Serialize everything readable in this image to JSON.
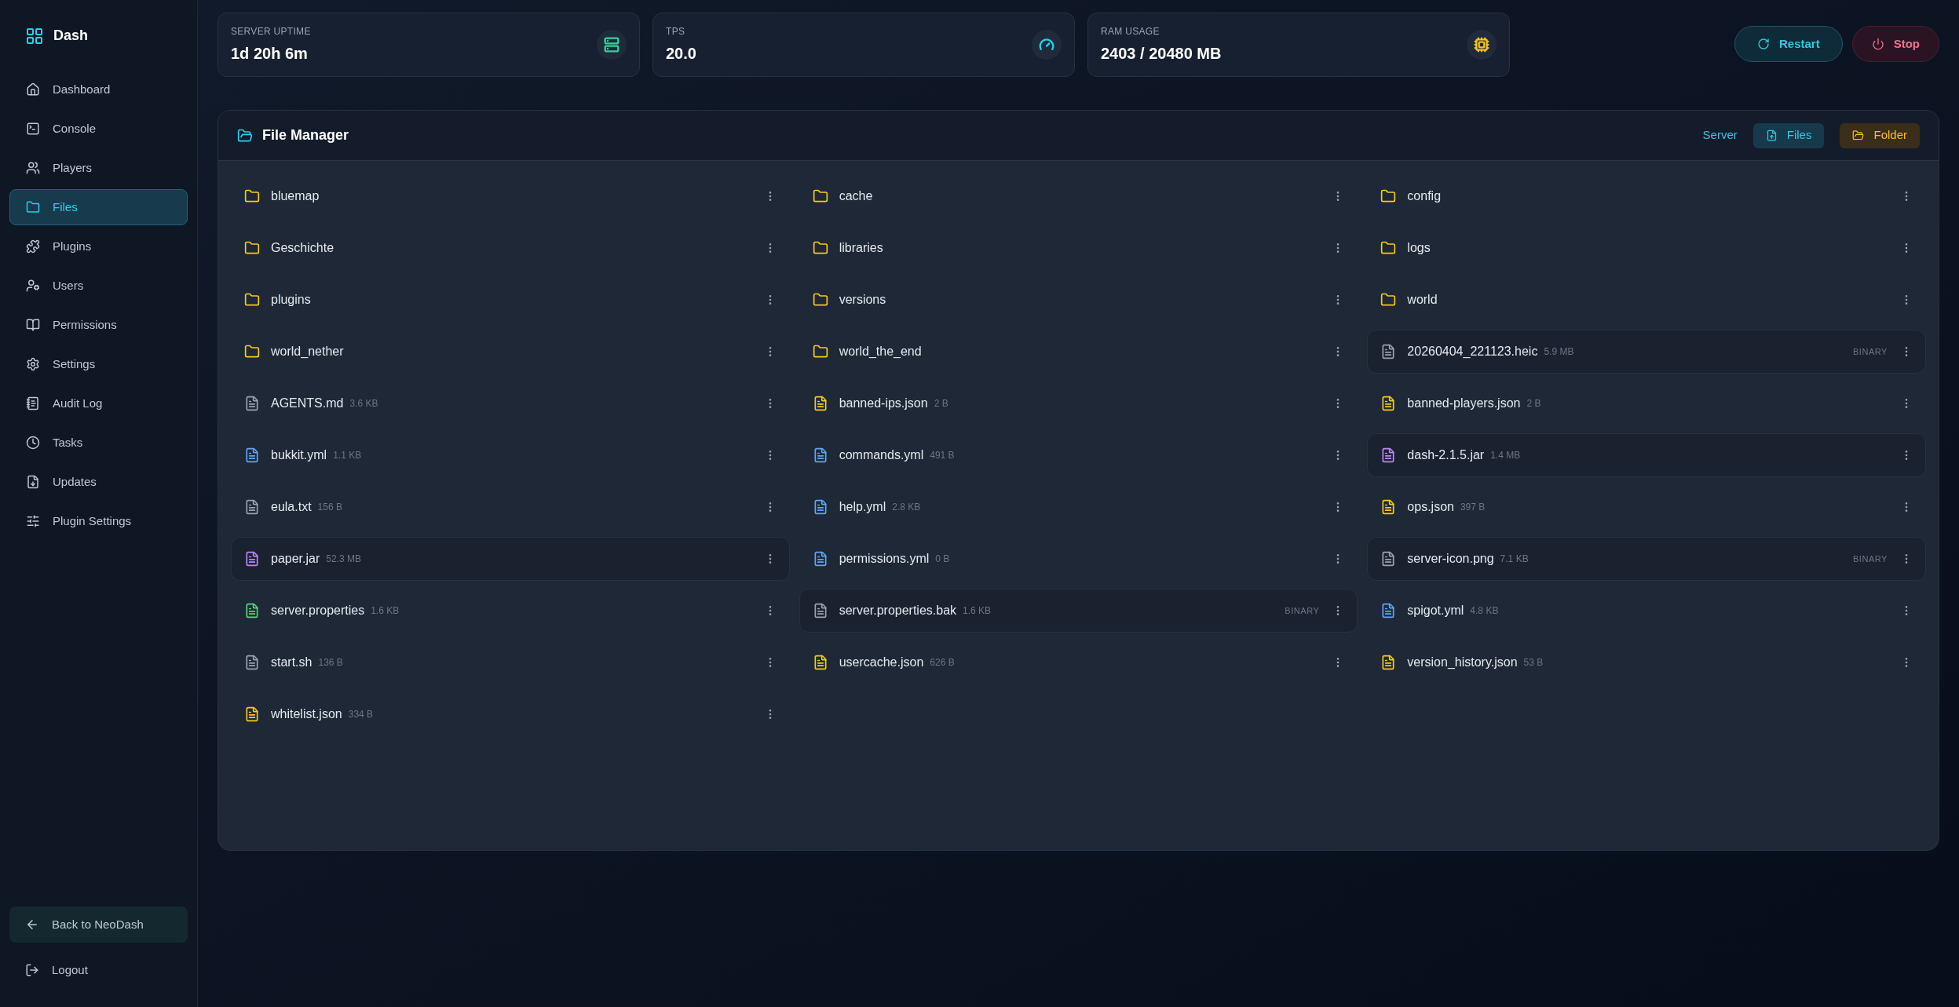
{
  "sidebar": {
    "brand": "Dash",
    "items": [
      {
        "label": "Dashboard",
        "selected": false
      },
      {
        "label": "Console",
        "selected": false
      },
      {
        "label": "Players",
        "selected": false
      },
      {
        "label": "Files",
        "selected": true
      },
      {
        "label": "Plugins",
        "selected": false
      },
      {
        "label": "Users",
        "selected": false
      },
      {
        "label": "Permissions",
        "selected": false
      },
      {
        "label": "Settings",
        "selected": false
      },
      {
        "label": "Audit Log",
        "selected": false
      },
      {
        "label": "Tasks",
        "selected": false
      },
      {
        "label": "Updates",
        "selected": false
      },
      {
        "label": "Plugin Settings",
        "selected": false
      }
    ],
    "footer": [
      {
        "label": "Back to NeoDash",
        "kind": "back"
      },
      {
        "label": "Logout",
        "kind": "logout"
      }
    ]
  },
  "stats": [
    {
      "label": "SERVER UPTIME",
      "value": "1d 20h 6m",
      "color": "#34d399"
    },
    {
      "label": "TPS",
      "value": "20.0",
      "color": "#22d3ee"
    },
    {
      "label": "RAM USAGE",
      "value": "2403 / 20480 MB",
      "color": "#fbbf24"
    }
  ],
  "actions": [
    {
      "label": "Restart",
      "kind": "restart"
    },
    {
      "label": "Stop",
      "kind": "stop"
    }
  ],
  "file_manager": {
    "title": "File Manager",
    "breadcrumb": "Server",
    "buttons": [
      {
        "label": "Files",
        "kind": "upload"
      },
      {
        "label": "Folder",
        "kind": "folder"
      }
    ],
    "items": [
      {
        "name": "bluemap",
        "kind": "folder",
        "color": "#facc15",
        "selected": false
      },
      {
        "name": "cache",
        "kind": "folder",
        "color": "#facc15",
        "selected": false
      },
      {
        "name": "config",
        "kind": "folder",
        "color": "#facc15",
        "selected": false
      },
      {
        "name": "Geschichte",
        "kind": "folder",
        "color": "#facc15",
        "selected": false
      },
      {
        "name": "libraries",
        "kind": "folder",
        "color": "#facc15",
        "selected": false
      },
      {
        "name": "logs",
        "kind": "folder",
        "color": "#facc15",
        "selected": false
      },
      {
        "name": "plugins",
        "kind": "folder",
        "color": "#facc15",
        "selected": false
      },
      {
        "name": "versions",
        "kind": "folder",
        "color": "#facc15",
        "selected": false
      },
      {
        "name": "world",
        "kind": "folder",
        "color": "#facc15",
        "selected": false
      },
      {
        "name": "world_nether",
        "kind": "folder",
        "color": "#facc15",
        "selected": false
      },
      {
        "name": "world_the_end",
        "kind": "folder",
        "color": "#facc15",
        "selected": false
      },
      {
        "name": "20260404_221123.heic",
        "kind": "file",
        "size": "5.9 MB",
        "badge": "BINARY",
        "color": "#9ca3af",
        "selected": true
      },
      {
        "name": "AGENTS.md",
        "kind": "file",
        "size": "3.6 KB",
        "color": "#9ca3af",
        "selected": false
      },
      {
        "name": "banned-ips.json",
        "kind": "file",
        "size": "2 B",
        "color": "#facc15",
        "selected": false
      },
      {
        "name": "banned-players.json",
        "kind": "file",
        "size": "2 B",
        "color": "#facc15",
        "selected": false
      },
      {
        "name": "bukkit.yml",
        "kind": "file",
        "size": "1.1 KB",
        "color": "#60a5fa",
        "selected": false
      },
      {
        "name": "commands.yml",
        "kind": "file",
        "size": "491 B",
        "color": "#60a5fa",
        "selected": false
      },
      {
        "name": "dash-2.1.5.jar",
        "kind": "file",
        "size": "1.4 MB",
        "color": "#c084fc",
        "selected": true
      },
      {
        "name": "eula.txt",
        "kind": "file",
        "size": "156 B",
        "color": "#9ca3af",
        "selected": false
      },
      {
        "name": "help.yml",
        "kind": "file",
        "size": "2.8 KB",
        "color": "#60a5fa",
        "selected": false
      },
      {
        "name": "ops.json",
        "kind": "file",
        "size": "397 B",
        "color": "#facc15",
        "selected": false
      },
      {
        "name": "paper.jar",
        "kind": "file",
        "size": "52.3 MB",
        "color": "#c084fc",
        "selected": true
      },
      {
        "name": "permissions.yml",
        "kind": "file",
        "size": "0 B",
        "color": "#60a5fa",
        "selected": false
      },
      {
        "name": "server-icon.png",
        "kind": "file",
        "size": "7.1 KB",
        "badge": "BINARY",
        "color": "#9ca3af",
        "selected": true
      },
      {
        "name": "server.properties",
        "kind": "file",
        "size": "1.6 KB",
        "color": "#4ade80",
        "selected": false
      },
      {
        "name": "server.properties.bak",
        "kind": "file",
        "size": "1.6 KB",
        "badge": "BINARY",
        "color": "#9ca3af",
        "selected": true
      },
      {
        "name": "spigot.yml",
        "kind": "file",
        "size": "4.8 KB",
        "color": "#60a5fa",
        "selected": false
      },
      {
        "name": "start.sh",
        "kind": "file",
        "size": "136 B",
        "color": "#9ca3af",
        "selected": false
      },
      {
        "name": "usercache.json",
        "kind": "file",
        "size": "626 B",
        "color": "#facc15",
        "selected": false
      },
      {
        "name": "version_history.json",
        "kind": "file",
        "size": "53 B",
        "color": "#facc15",
        "selected": false
      },
      {
        "name": "whitelist.json",
        "kind": "file",
        "size": "334 B",
        "color": "#facc15",
        "selected": false
      }
    ]
  }
}
